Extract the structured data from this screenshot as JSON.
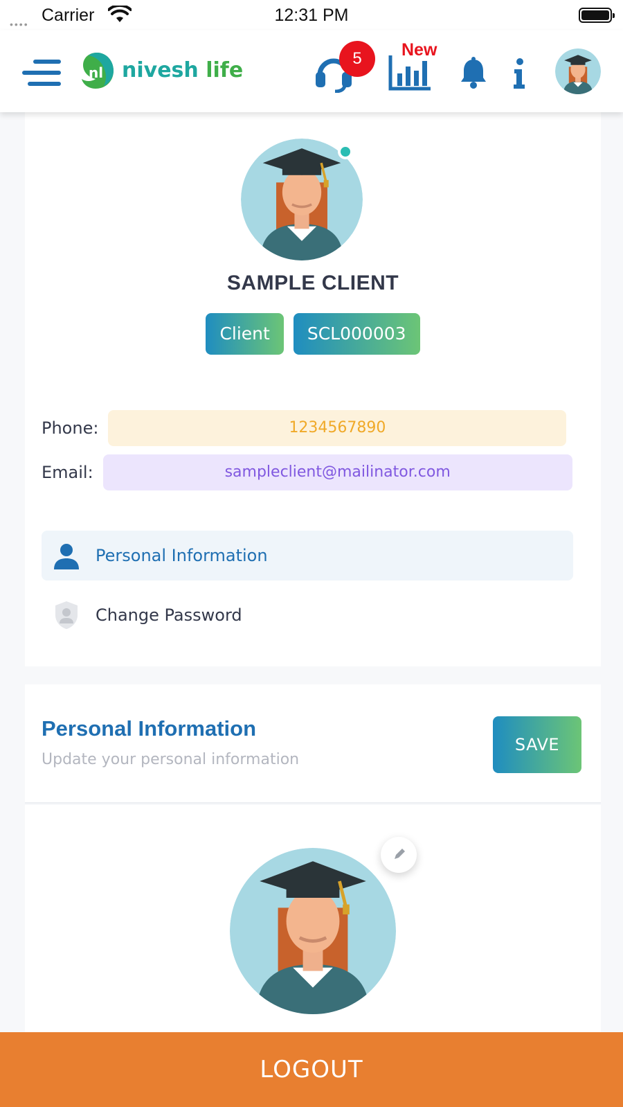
{
  "status_bar": {
    "carrier": "Carrier",
    "time": "12:31 PM"
  },
  "header": {
    "logo_text_part1": "nivesh",
    "logo_text_part2": "life",
    "support_badge_count": "5",
    "chart_new_label": "New",
    "icons": [
      "menu-icon",
      "support-headset-icon",
      "bar-chart-icon",
      "bell-icon",
      "info-icon",
      "avatar"
    ]
  },
  "profile": {
    "name": "SAMPLE CLIENT",
    "role_chip": "Client",
    "id_chip": "SCL000003",
    "phone_label": "Phone:",
    "phone_value": "1234567890",
    "email_label": "Email:",
    "email_value": "sampleclient@mailinator.com",
    "menu": [
      {
        "label": "Personal Information",
        "icon": "person-icon",
        "active": true
      },
      {
        "label": "Change Password",
        "icon": "shield-user-icon",
        "active": false
      }
    ]
  },
  "personal_info": {
    "title": "Personal Information",
    "subtitle": "Update your personal information",
    "save_label": "SAVE"
  },
  "footer": {
    "logout_label": "LOGOUT"
  },
  "colors": {
    "brand_blue": "#1f6fb2",
    "gradient_start": "#1f8dc0",
    "gradient_end": "#6cc576",
    "logout_orange": "#e87f30",
    "badge_red": "#e8141e",
    "online_teal": "#2bbdb3"
  }
}
